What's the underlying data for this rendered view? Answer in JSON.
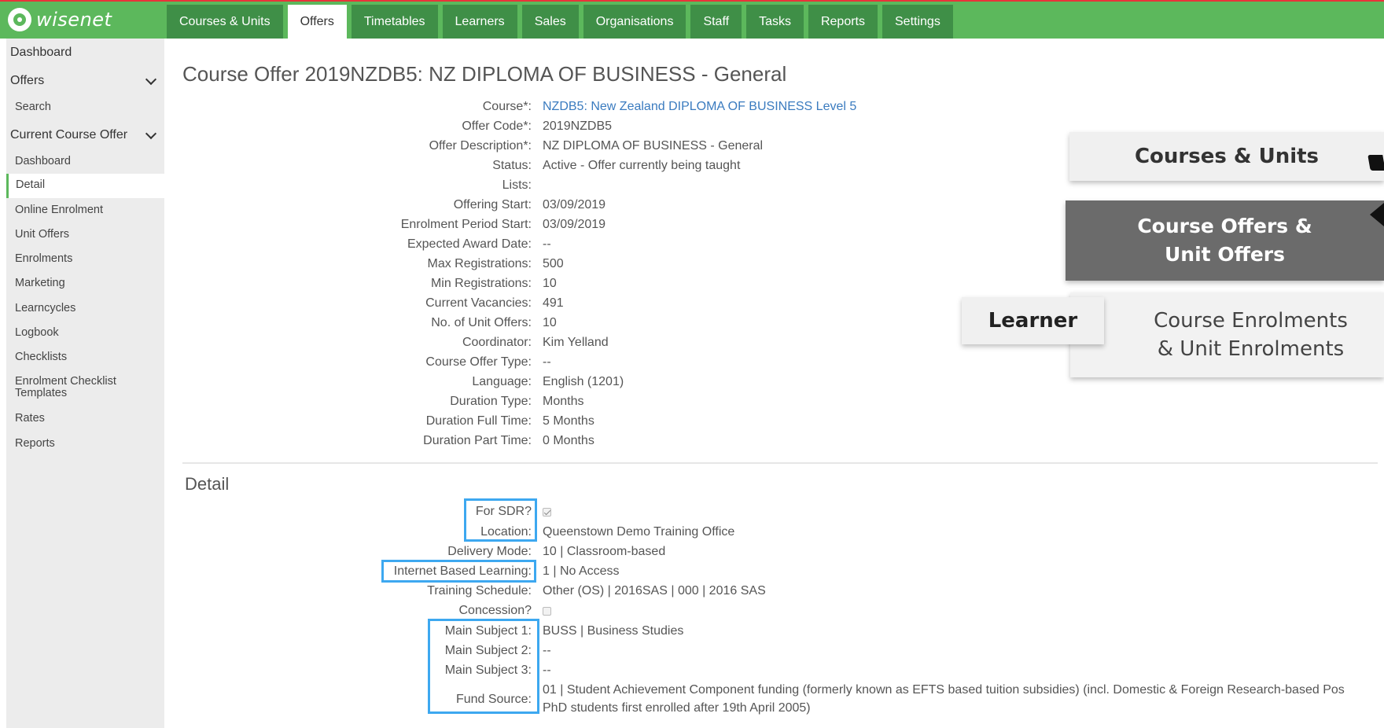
{
  "brand": {
    "logo_text": "wisenet"
  },
  "topnav": {
    "tabs": [
      {
        "label": "Courses & Units"
      },
      {
        "label": "Offers"
      },
      {
        "label": "Timetables"
      },
      {
        "label": "Learners"
      },
      {
        "label": "Sales"
      },
      {
        "label": "Organisations"
      },
      {
        "label": "Staff"
      },
      {
        "label": "Tasks"
      },
      {
        "label": "Reports"
      },
      {
        "label": "Settings"
      }
    ],
    "active_tab": "Offers"
  },
  "sidebar": {
    "dashboard": "Dashboard",
    "offers": "Offers",
    "search": "Search",
    "current_course_offer": "Current Course Offer",
    "items": [
      {
        "label": "Dashboard"
      },
      {
        "label": "Detail"
      },
      {
        "label": "Online Enrolment"
      },
      {
        "label": "Unit Offers"
      },
      {
        "label": "Enrolments"
      },
      {
        "label": "Marketing"
      },
      {
        "label": "Learncycles"
      },
      {
        "label": "Logbook"
      },
      {
        "label": "Checklists"
      },
      {
        "label": "Enrolment Checklist"
      },
      {
        "label": "Templates"
      },
      {
        "label": "Rates"
      },
      {
        "label": "Reports"
      }
    ]
  },
  "page": {
    "title": "Course Offer 2019NZDB5: NZ DIPLOMA OF BUSINESS - General"
  },
  "fields": [
    {
      "label": "Course*:",
      "value": "NZDB5: New Zealand DIPLOMA OF BUSINESS Level 5"
    },
    {
      "label": "Offer Code*:",
      "value": "2019NZDB5"
    },
    {
      "label": "Offer Description*:",
      "value": "NZ DIPLOMA OF BUSINESS - General"
    },
    {
      "label": "Status:",
      "value": "Active - Offer currently being taught"
    },
    {
      "label": "Lists:",
      "value": ""
    },
    {
      "label": "Offering Start:",
      "value": "03/09/2019"
    },
    {
      "label": "Enrolment Period Start:",
      "value": "03/09/2019"
    },
    {
      "label": "Expected Award Date:",
      "value": "--"
    },
    {
      "label": "Max Registrations:",
      "value": "500"
    },
    {
      "label": "Min Registrations:",
      "value": "10"
    },
    {
      "label": "Current Vacancies:",
      "value": "491"
    },
    {
      "label": "No. of Unit Offers:",
      "value": "10"
    },
    {
      "label": "Coordinator:",
      "value": "Kim Yelland"
    },
    {
      "label": "Course Offer Type:",
      "value": "--"
    },
    {
      "label": "Language:",
      "value": "English (1201)"
    },
    {
      "label": "Duration Type:",
      "value": "Months"
    },
    {
      "label": "Duration Full Time:",
      "value": "5 Months"
    },
    {
      "label": "Duration Part Time:",
      "value": "0 Months"
    }
  ],
  "detail": {
    "title": "Detail",
    "for_sdr_label": "For SDR?",
    "for_sdr_checked": true,
    "location_label": "Location:",
    "location_value": "Queenstown Demo Training Office",
    "delivery_mode_label": "Delivery Mode:",
    "delivery_mode_value": "10 | Classroom-based",
    "internet_label": "Internet Based Learning:",
    "internet_value": "1 | No Access",
    "training_schedule_label": "Training Schedule:",
    "training_schedule_value": "Other (OS) | 2016SAS | 000 | 2016 SAS",
    "concession_label": "Concession?",
    "concession_checked": false,
    "main_subject_1_label": "Main Subject 1:",
    "main_subject_1_value": "BUSS | Business Studies",
    "main_subject_2_label": "Main Subject 2:",
    "main_subject_2_value": "--",
    "main_subject_3_label": "Main Subject 3:",
    "main_subject_3_value": "--",
    "fund_source_label": "Fund Source:",
    "fund_source_line1": "01 | Student Achievement Component funding (formerly known as EFTS based tuition subsidies) (incl. Domestic & Foreign Research-based Pos",
    "fund_source_line2": "PhD students first enrolled after 19th April 2005)"
  },
  "overlay": {
    "courses_units": "Courses & Units",
    "course_offers_line1": "Course Offers &",
    "course_offers_line2": "Unit Offers",
    "learner": "Learner",
    "enrolments_line1": "Course Enrolments",
    "enrolments_line2": "& Unit Enrolments"
  },
  "colors": {
    "nav_green": "#5cb85c",
    "tab_dark_green": "#3f8f47",
    "link_blue": "#3a7bbf",
    "highlight_blue": "#3da8f0",
    "overlay_dark": "#6b6b6b"
  }
}
